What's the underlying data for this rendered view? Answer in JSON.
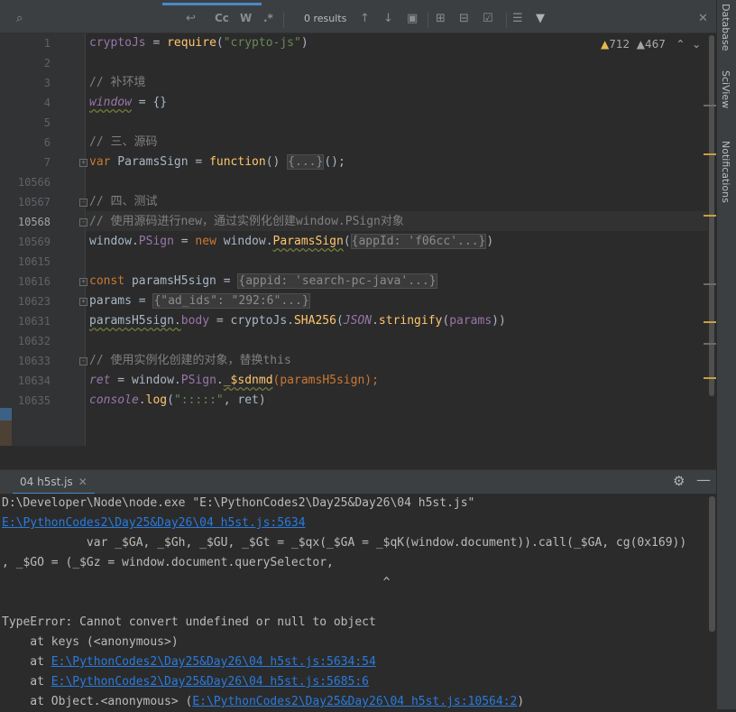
{
  "find_bar": {
    "search_value": "",
    "search_icon": "search-icon",
    "match_case_label": "Cc",
    "words_label": "W",
    "regex_label": ".*",
    "results_text": "0 results"
  },
  "editor": {
    "lines": [
      {
        "num": "1"
      },
      {
        "num": "2"
      },
      {
        "num": "3"
      },
      {
        "num": "4"
      },
      {
        "num": "5"
      },
      {
        "num": "6"
      },
      {
        "num": "7"
      },
      {
        "num": "10566"
      },
      {
        "num": "10567"
      },
      {
        "num": "10568"
      },
      {
        "num": "10569"
      },
      {
        "num": "10615"
      },
      {
        "num": "10616"
      },
      {
        "num": "10623"
      },
      {
        "num": "10631"
      },
      {
        "num": "10632"
      },
      {
        "num": "10633"
      },
      {
        "num": "10634"
      },
      {
        "num": "10635"
      }
    ],
    "code": {
      "l1_var": "cryptoJs",
      "l1_eq": " = ",
      "l1_fn": "require",
      "l1_p1": "(",
      "l1_str": "\"crypto-js\"",
      "l1_p2": ")",
      "l3": "// 补环境",
      "l4_var": "window",
      "l4_rest": " = {}",
      "l6": "// 三、源码",
      "l7_kw": "var",
      "l7_name": " ParamsSign = ",
      "l7_fn": "function",
      "l7_p": "() ",
      "l7_fold": "{...}",
      "l7_end": "();",
      "l10567": "// 四、测试",
      "l10568": "// 使用源码进行new，通过实例化创建window.PSign对象",
      "l10569_a": "window.",
      "l10569_prop": "PSign",
      "l10569_b": " = ",
      "l10569_kw": "new",
      "l10569_c": " window.",
      "l10569_fn": "ParamsSign",
      "l10569_p": "(",
      "l10569_fold": "{appId: 'f06cc'...}",
      "l10569_end": ")",
      "l10616_kw": "const",
      "l10616_name": " paramsH5sign = ",
      "l10616_fold": "{appid: 'search-pc-java'...}",
      "l10623_name": "params = ",
      "l10623_fold": "{\"ad_ids\": \"292:6\"...}",
      "l10631_a": "paramsH5sign.",
      "l10631_prop": "body",
      "l10631_b": " = cryptoJs.",
      "l10631_fn": "SHA256",
      "l10631_c": "(",
      "l10631_json": "JSON",
      "l10631_d": ".",
      "l10631_fn2": "stringify",
      "l10631_e": "(",
      "l10631_par": "params",
      "l10631_f": "))",
      "l10633": "// 使用实例化创建的对象，替换this",
      "l10634_var": "ret",
      "l10634_a": " = window.",
      "l10634_prop": "PSign",
      "l10634_b": ".",
      "l10634_fn": "_$sdnmd",
      "l10634_c": "(paramsH5sign);",
      "l10635_var": "console",
      "l10635_a": ".",
      "l10635_fn": "log",
      "l10635_b": "(",
      "l10635_str": "\":::::\"",
      "l10635_c": ", ret)"
    },
    "warnings_count": "712",
    "weak_warnings_count": "467"
  },
  "right_tools": [
    "Database",
    "SciView",
    "Notifications"
  ],
  "run_panel": {
    "tab_label": "04 h5st.js",
    "console_lines": {
      "c1": "D:\\Developer\\Node\\node.exe \"E:\\PythonCodes2\\Day25&Day26\\04 h5st.js\"",
      "c2": "E:\\PythonCodes2\\Day25&Day26\\04 h5st.js:5634",
      "c3": "            var _$GA, _$Gh, _$GU, _$Gt = _$qx(_$GA = _$qK(window.document)).call(_$GA, cg(0x169))",
      "c4": ", _$GO = (_$Gz = window.document.querySelector,",
      "c5": "                                                      ^",
      "c6": "TypeError: Cannot convert undefined or null to object",
      "c7": "    at keys (<anonymous>)",
      "c8_pre": "    at ",
      "c8_link": "E:\\PythonCodes2\\Day25&Day26\\04 h5st.js:5634:54",
      "c9_pre": "    at ",
      "c9_link": "E:\\PythonCodes2\\Day25&Day26\\04 h5st.js:5685:6",
      "c10_pre": "    at Object.<anonymous> (",
      "c10_link": "E:\\PythonCodes2\\Day25&Day26\\04 h5st.js:10564:2",
      "c10_post": ")"
    }
  },
  "colors": {
    "accent": "#4a88c7",
    "link": "#287bde",
    "keyword": "#cc7832",
    "string": "#6a8759",
    "function": "#ffc66d"
  }
}
